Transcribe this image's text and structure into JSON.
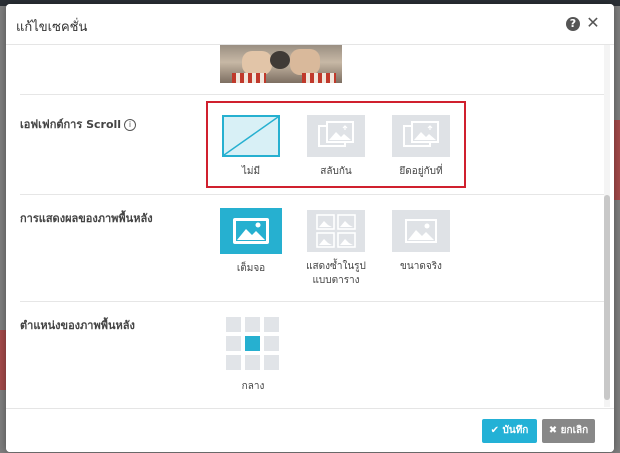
{
  "colors": {
    "accent": "#26b0d0",
    "highlight": "#d0202e",
    "cancel": "#888888"
  },
  "header": {
    "title": "แก้ไขเซคชั่น",
    "help_icon": "?",
    "close_icon": "✕"
  },
  "scroll_effect": {
    "label": "เอฟเฟกต์การ Scroll",
    "info_icon": "i",
    "options": [
      {
        "label": "ไม่มี",
        "icon": "none-icon",
        "selected": true
      },
      {
        "label": "สลับกัน",
        "icon": "parallax-image-icon",
        "selected": false
      },
      {
        "label": "ยึดอยู่กับที่",
        "icon": "fixed-image-icon",
        "selected": false
      }
    ]
  },
  "background_display": {
    "label": "การแสดงผลของภาพพื้นหลัง",
    "options": [
      {
        "label": "เต็มจอ",
        "icon": "image-icon",
        "selected": true
      },
      {
        "label": "แสดงซ้ำในรูปแบบตาราง",
        "line1": "แสดงซ้ำในรูป",
        "line2": "แบบตาราง",
        "icon": "tiled-images-icon",
        "selected": false
      },
      {
        "label": "ขนาดจริง",
        "icon": "image-icon",
        "selected": false
      }
    ]
  },
  "background_position": {
    "label": "ตำแหน่งของภาพพื้นหลัง",
    "selected": "กลาง",
    "grid_selected_index": 4
  },
  "footer": {
    "save_label": "บันทึก",
    "save_icon": "✔",
    "cancel_label": "ยกเลิก",
    "cancel_icon": "✖"
  }
}
